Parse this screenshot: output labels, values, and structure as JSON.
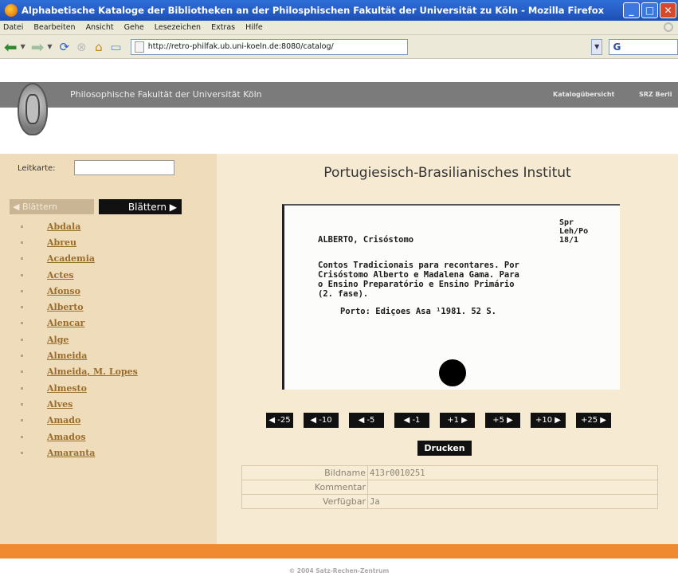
{
  "window": {
    "title": "Alphabetische Kataloge der Bibliotheken an der Philosphischen Fakultät der Universität zu Köln - Mozilla Firefox",
    "minimize": "_",
    "maximize": "□",
    "close": "✕"
  },
  "menu": [
    "Datei",
    "Bearbeiten",
    "Ansicht",
    "Gehe",
    "Lesezeichen",
    "Extras",
    "Hilfe"
  ],
  "nav": {
    "url": "http://retro-philfak.ub.uni-koeln.de:8080/catalog/",
    "search_glyph": "G"
  },
  "header": {
    "title": "Philosophische Fakultät der Universität Köln",
    "link_overview": "Katalogübersicht",
    "link_srz": "SRZ Berli"
  },
  "sidebar": {
    "leitkarte_label": "Leitkarte:",
    "leitkarte_value": "",
    "prev_label": "◀ Blättern",
    "next_label": "Blättern ▶",
    "items": [
      "Abdala",
      "Abreu",
      "Academia",
      "Actes",
      "Afonso",
      "Alberto",
      "Alencar",
      "Alge",
      "Almeida",
      "Almeida, M. Lopes",
      "Almesto",
      "Alves",
      "Amado",
      "Amados",
      "Amaranta"
    ]
  },
  "main": {
    "institute": "Portugiesisch-Brasilianisches Institut",
    "card": {
      "shelf": [
        "Spr",
        "Leh/Po",
        "18/1"
      ],
      "author": "ALBERTO, Crisóstomo",
      "body": [
        "Contos Tradicionais para recontares. Por",
        "Crisóstomo Alberto e Madalena Gama. Para",
        "o Ensino Preparatório e Ensino Primário",
        "(2. fase)."
      ],
      "imprint": "Porto: Ediçoes Asa ¹1981. 52 S."
    },
    "pager": [
      "◀ -25",
      "◀ -10",
      "◀ -5",
      "◀ -1",
      "+1 ▶",
      "+5 ▶",
      "+10 ▶",
      "+25 ▶"
    ],
    "print_label": "Drucken",
    "info": {
      "bildname_label": "Bildname",
      "bildname_value": "413r0010251",
      "kommentar_label": "Kommentar",
      "kommentar_value": "",
      "verfuegbar_label": "Verfügbar",
      "verfuegbar_value": "Ja"
    }
  },
  "footer": {
    "text": "© 2004 Satz-Rechen-Zentrum"
  }
}
